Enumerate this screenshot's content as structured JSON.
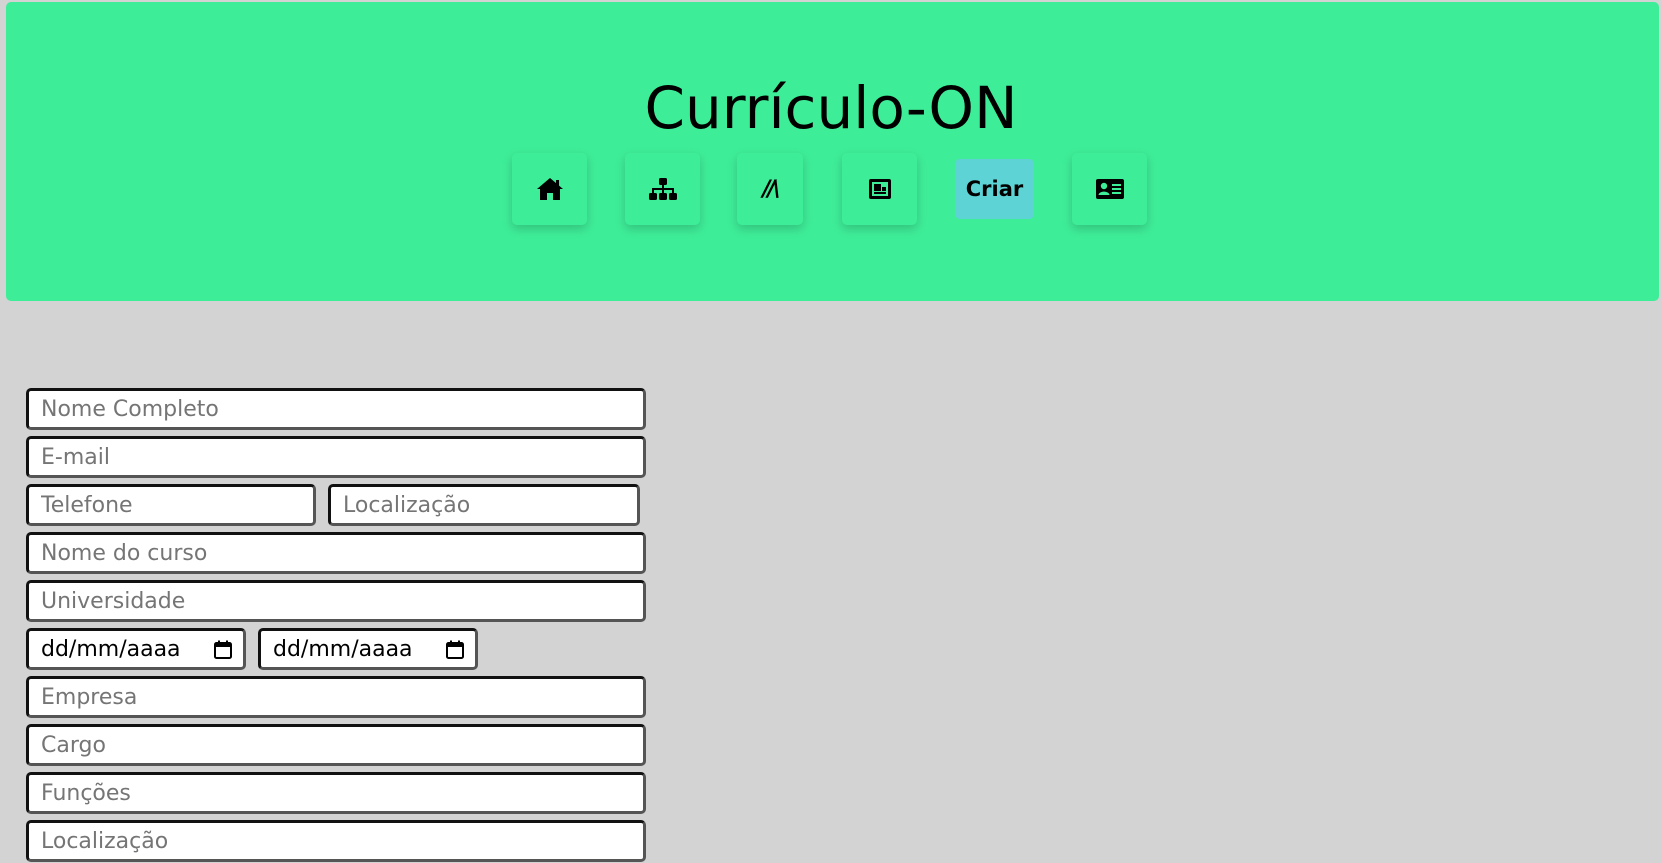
{
  "header": {
    "title": "Currículo-ON",
    "background_color": "#3eed98"
  },
  "nav": {
    "items": [
      {
        "name": "home-icon",
        "label": ""
      },
      {
        "name": "sitemap-icon",
        "label": ""
      },
      {
        "name": "books-icon",
        "label": "//\\"
      },
      {
        "name": "portfolio-icon",
        "label": ""
      },
      {
        "name": "criar",
        "label": "Criar",
        "active": true,
        "color": "#5ed3d5"
      },
      {
        "name": "id-card-icon",
        "label": ""
      }
    ]
  },
  "form": {
    "full_name": {
      "placeholder": "Nome Completo",
      "value": ""
    },
    "email": {
      "placeholder": "E-mail",
      "value": ""
    },
    "phone": {
      "placeholder": "Telefone",
      "value": ""
    },
    "location": {
      "placeholder": "Localização",
      "value": ""
    },
    "course_name": {
      "placeholder": "Nome do curso",
      "value": ""
    },
    "university": {
      "placeholder": "Universidade",
      "value": ""
    },
    "start_date": {
      "value": "dd/mm/aaaa"
    },
    "end_date": {
      "value": "dd/mm/aaaa"
    },
    "company": {
      "placeholder": "Empresa",
      "value": ""
    },
    "role": {
      "placeholder": "Cargo",
      "value": ""
    },
    "functions": {
      "placeholder": "Funções",
      "value": ""
    },
    "job_location": {
      "placeholder": "Localização",
      "value": ""
    }
  },
  "page": {
    "background_color": "#d3d3d3"
  }
}
